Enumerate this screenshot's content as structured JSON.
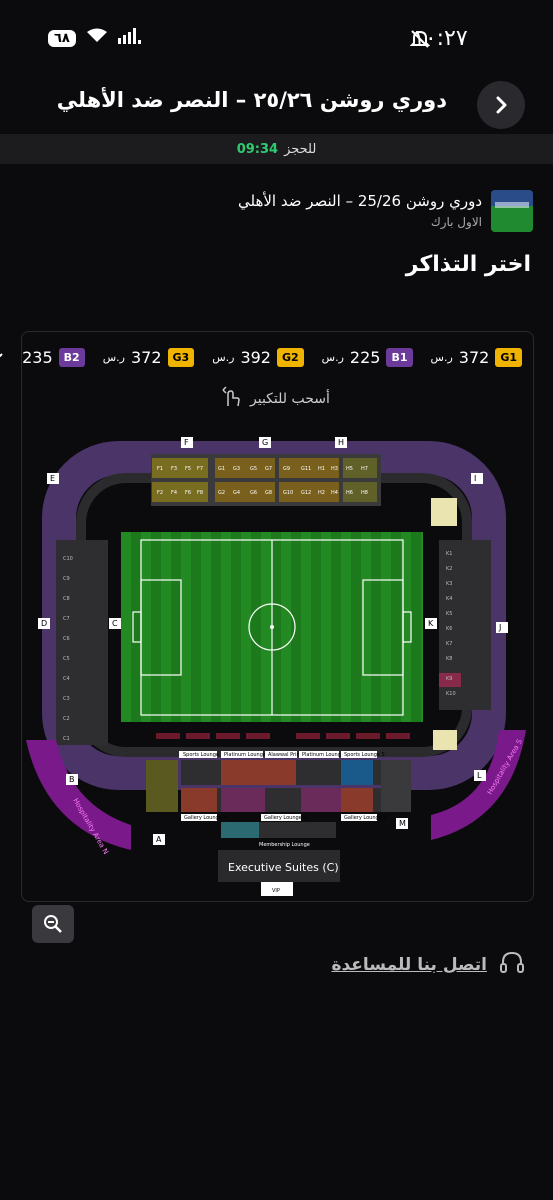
{
  "status": {
    "time": "١٠:٢٧",
    "battery": "٦٨"
  },
  "header": {
    "title": "دوري روشن ٢٥/٢٦ – النصر ضد الأهلي"
  },
  "timer": {
    "value": "09:34",
    "label": "للحجز"
  },
  "event": {
    "name": "دوري روشن 25/26 – النصر ضد الأهلي",
    "venue": "الاول بارك"
  },
  "section_title": "اختر التذاكر",
  "legend": [
    {
      "code": "G1",
      "price": "372",
      "color": "#f0b400"
    },
    {
      "code": "B1",
      "price": "225",
      "color": "#6b3a9a"
    },
    {
      "code": "G2",
      "price": "392",
      "color": "#f0b400"
    },
    {
      "code": "G3",
      "price": "372",
      "color": "#f0b400"
    },
    {
      "code": "B2",
      "price": "235",
      "color": "#6b3a9a"
    }
  ],
  "currency": "ر.س",
  "drag_hint": "أسحب للتكبير",
  "stands": [
    "A",
    "B",
    "C",
    "D",
    "E",
    "F",
    "G",
    "H",
    "I",
    "J",
    "K",
    "L",
    "M"
  ],
  "left_blocks": [
    "C10",
    "C9",
    "C8",
    "C7",
    "C6",
    "C5",
    "C4",
    "C3",
    "C2",
    "C1"
  ],
  "right_blocks": [
    "K1",
    "K2",
    "K3",
    "K4",
    "K5",
    "K6",
    "K7",
    "K8",
    "K9",
    "K10"
  ],
  "top_blocks": [
    "F1",
    "F2",
    "F3",
    "F4",
    "F5",
    "F6",
    "F7",
    "F8",
    "G1",
    "G2",
    "G3",
    "G4",
    "G5",
    "G6",
    "G7",
    "G8",
    "G9",
    "G10",
    "G11",
    "G12",
    "H1",
    "H2",
    "H3",
    "H4",
    "H5",
    "H6",
    "H7",
    "H8"
  ],
  "lounges": {
    "sports_n": "Sports Lounge N",
    "platinum_n": "Platinum Lounge N",
    "alawwal_prime": "Alawwal Prime",
    "platinum_s": "Platinum Lounge S",
    "sports_s": "Sports Lounge S",
    "gallery_n": "Gallery Lounge N",
    "gallery_c": "Gallery Lounge C",
    "gallery_s": "Gallery Lounge S",
    "membership": "Membership Lounge",
    "exec_suites": "Executive Suites (C)",
    "vip": "VIP",
    "hospitality_n": "Hospitality Area N",
    "hospitality_s": "Hospitality Area S"
  },
  "help": {
    "text": "اتصل بنا للمساعدة"
  },
  "colors": {
    "pitch": "#1e7a1e",
    "gold": "#f0b400",
    "purple": "#6b3a9a",
    "seat_dark": "#2b2b2e"
  }
}
